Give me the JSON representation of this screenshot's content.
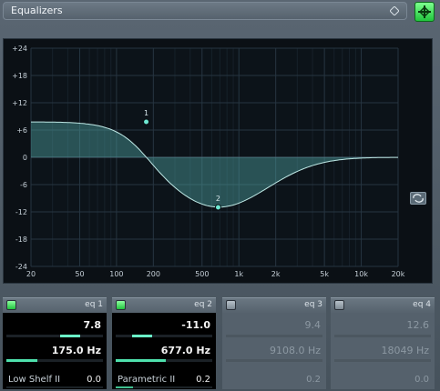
{
  "window": {
    "title": "Equalizers"
  },
  "graph": {
    "y_ticks": [
      "+24",
      "+18",
      "+12",
      "+6",
      "0",
      "-6",
      "-12",
      "-18",
      "-24"
    ],
    "x_ticks": [
      "20",
      "50",
      "100",
      "200",
      "500",
      "1k",
      "2k",
      "5k",
      "10k",
      "20k"
    ],
    "points": [
      {
        "label": "1"
      },
      {
        "label": "2"
      }
    ]
  },
  "bands": [
    {
      "label": "eq 1",
      "enabled": true,
      "gain": "7.8",
      "gain_level": 0.66,
      "freq": "175.0 Hz",
      "freq_level": 0.32,
      "type": "Low Shelf II",
      "q": "0.0",
      "q_level": 0.0
    },
    {
      "label": "eq 2",
      "enabled": true,
      "gain": "-11.0",
      "gain_level": 0.27,
      "freq": "677.0 Hz",
      "freq_level": 0.52,
      "type": "Parametric II",
      "q": "0.2",
      "q_level": 0.18
    },
    {
      "label": "eq 3",
      "enabled": false,
      "gain": "9.4",
      "gain_level": 0.7,
      "freq": "9108.0 Hz",
      "freq_level": 0.84,
      "type": "",
      "q": "0.2",
      "q_level": 0.18
    },
    {
      "label": "eq 4",
      "enabled": false,
      "gain": "12.6",
      "gain_level": 0.76,
      "freq": "18049 Hz",
      "freq_level": 0.95,
      "type": "",
      "q": "0.0",
      "q_level": 0.0
    }
  ]
}
